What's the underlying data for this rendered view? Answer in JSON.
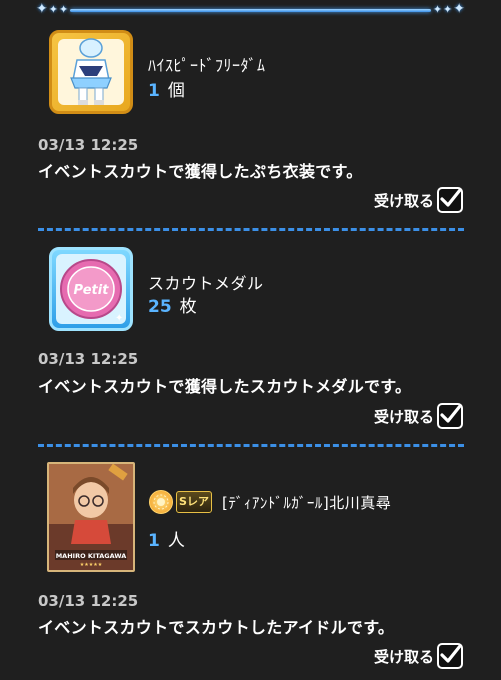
{
  "items": [
    {
      "name": "ﾊｲｽﾋﾟｰﾄﾞﾌﾘｰﾀﾞﾑ",
      "quantity": "1",
      "unit": "個",
      "date": "03/13 12:25",
      "description": "イベントスカウトで獲得したぷち衣装です。",
      "receive_label": "受け取る",
      "checked": true,
      "icon": "petit-costume-icon"
    },
    {
      "name": "スカウトメダル",
      "quantity": "25",
      "unit": "枚",
      "date": "03/13 12:25",
      "description": "イベントスカウトで獲得したスカウトメダルです。",
      "receive_label": "受け取る",
      "checked": true,
      "icon": "scout-medal-icon",
      "medal_text": "Petit"
    },
    {
      "name": "[ﾃﾞｨｱﾝﾄﾞﾙｶﾞｰﾙ]北川真尋",
      "quantity": "1",
      "unit": "人",
      "date": "03/13 12:25",
      "description": "イベントスカウトでスカウトしたアイドルです。",
      "receive_label": "受け取る",
      "checked": true,
      "icon": "idol-card-thumbnail",
      "rarity": "Sレア",
      "attribute_icon": "passion-attribute-icon",
      "card_caption": "MAHIRO KITAGAWA"
    }
  ],
  "colors": {
    "background": "#1f1f1f",
    "accent_blue": "#5ab4ff",
    "divider": "#3b8fe6"
  }
}
